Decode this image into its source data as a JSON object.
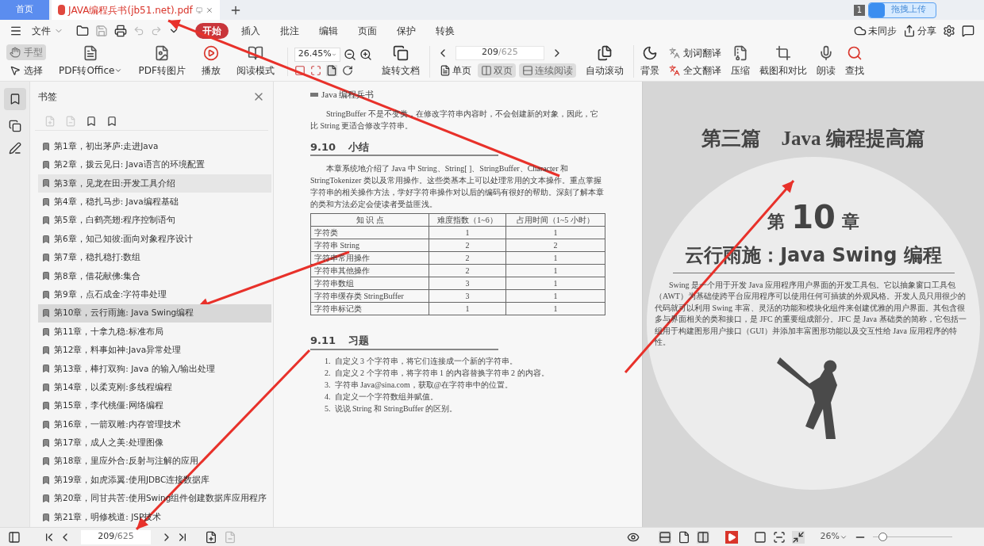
{
  "tabs": [
    {
      "label": "首页",
      "selected": false,
      "kind": "home"
    },
    {
      "label": "JAVA编程兵书(jb51.net).pdf",
      "selected": true,
      "kind": "document"
    }
  ],
  "window_badge": "1",
  "upload_button": "拖拽上传",
  "menu": {
    "file": "文件",
    "tabs": [
      {
        "label": "开始",
        "selected": true
      },
      {
        "label": "插入",
        "selected": false
      },
      {
        "label": "批注",
        "selected": false
      },
      {
        "label": "编辑",
        "selected": false
      },
      {
        "label": "页面",
        "selected": false
      },
      {
        "label": "保护",
        "selected": false
      },
      {
        "label": "转换",
        "selected": false
      }
    ],
    "sync": "未同步",
    "share": "分享"
  },
  "toolbar": {
    "modes": [
      {
        "label": "手型",
        "selected": true,
        "kind": "hand"
      },
      {
        "label": "选择",
        "selected": false,
        "kind": "select"
      }
    ],
    "tools": [
      {
        "label": "PDF转Office",
        "kind": "office",
        "dropdown": true
      },
      {
        "label": "PDF转图片",
        "kind": "image",
        "dropdown": false
      },
      {
        "label": "播放",
        "kind": "play",
        "dropdown": false
      },
      {
        "label": "阅读模式",
        "kind": "read",
        "dropdown": false
      }
    ],
    "zoom": "26.45%",
    "rotate": "旋转文档",
    "page": "209",
    "page_total": "/625",
    "views": [
      {
        "label": "单页",
        "selected": false,
        "kind": "single"
      },
      {
        "label": "双页",
        "selected": true,
        "kind": "double"
      },
      {
        "label": "连续阅读",
        "selected": true,
        "kind": "continuous"
      }
    ],
    "auto_scroll": "自动滚动",
    "background": "背景",
    "translate": [
      {
        "label": "划词翻译",
        "kind": "word"
      },
      {
        "label": "全文翻译",
        "kind": "full"
      }
    ],
    "tools2": [
      {
        "label": "压缩",
        "kind": "compress"
      },
      {
        "label": "截图和对比",
        "kind": "screenshot"
      },
      {
        "label": "朗读",
        "kind": "read-aloud"
      },
      {
        "label": "查找",
        "kind": "find"
      }
    ]
  },
  "sidebar": {
    "title": "书签",
    "items": [
      {
        "label": "第1章，初出茅庐:走进Java",
        "selected": false,
        "hovered": false
      },
      {
        "label": "第2章，拨云见日: Java语言的环境配置",
        "selected": false,
        "hovered": false
      },
      {
        "label": "第3章，见龙在田:开发工具介绍",
        "selected": false,
        "hovered": true
      },
      {
        "label": "第4章，稳扎马步: Java编程基础",
        "selected": false,
        "hovered": false
      },
      {
        "label": "第5章，白鹤亮翅:程序控制语句",
        "selected": false,
        "hovered": false
      },
      {
        "label": "第6章，知己知彼:面向对象程序设计",
        "selected": false,
        "hovered": false
      },
      {
        "label": "第7章，稳扎稳打:数组",
        "selected": false,
        "hovered": false
      },
      {
        "label": "第8章，借花献佛:集合",
        "selected": false,
        "hovered": false
      },
      {
        "label": "第9章，点石成金:字符串处理",
        "selected": false,
        "hovered": false
      },
      {
        "label": "第10章，云行雨施: Java Swing编程",
        "selected": true,
        "hovered": false
      },
      {
        "label": "第11章，十拿九稳:标准布局",
        "selected": false,
        "hovered": false
      },
      {
        "label": "第12章，料事如神:Java异常处理",
        "selected": false,
        "hovered": false
      },
      {
        "label": "第13章，棒打双狗: Java 的输入/输出处理",
        "selected": false,
        "hovered": false
      },
      {
        "label": "第14章，以柔克刚:多线程编程",
        "selected": false,
        "hovered": false
      },
      {
        "label": "第15章，李代桃僵:网络编程",
        "selected": false,
        "hovered": false
      },
      {
        "label": "第16章，一箭双雕:内存管理技术",
        "selected": false,
        "hovered": false
      },
      {
        "label": "第17章，成人之美:处理图像",
        "selected": false,
        "hovered": false
      },
      {
        "label": "第18章，里应外合:反射与注解的应用",
        "selected": false,
        "hovered": false
      },
      {
        "label": "第19章，如虎添翼:使用JDBC连接数据库",
        "selected": false,
        "hovered": false
      },
      {
        "label": "第20章，同甘共苦:使用Swing组件创建数据库应用程序",
        "selected": false,
        "hovered": false
      },
      {
        "label": "第21章，明修栈道: JSP技术",
        "selected": false,
        "hovered": false
      }
    ]
  },
  "left_page": {
    "header": "Java 编程兵书",
    "intro": "StringBuffer 不是不变类，在修改字符串内容时，不会创建新的对象，因此，它比 String 更适合修改字符串。",
    "section1": {
      "number": "9.10",
      "title": "小结"
    },
    "summary": "本章系统地介绍了 Java 中 String、String[ ]、StringBuffer、Character 和 StringTokenizer 类以及常用操作。这些类基本上可以处理常用的文本操作。重点掌握字符串的相关操作方法，学好字符串操作对以后的编码有很好的帮助。深刻了解本章的类和方法必定会使读者受益匪浅。",
    "table": {
      "columns": [
        "知  识  点",
        "难度指数（1~6）",
        "占用时间（1~5 小时）"
      ],
      "rows": [
        [
          "字符类",
          "1",
          "1"
        ],
        [
          "字符串 String",
          "2",
          "2"
        ],
        [
          "字符串常用操作",
          "2",
          "1"
        ],
        [
          "字符串其他操作",
          "2",
          "1"
        ],
        [
          "字符串数组",
          "3",
          "1"
        ],
        [
          "字符串缓存类 StringBuffer",
          "3",
          "1"
        ],
        [
          "字符串标记类",
          "1",
          "1"
        ]
      ]
    },
    "section2": {
      "number": "9.11",
      "title": "习题"
    },
    "exercises": [
      "1.  自定义 3 个字符串，将它们连接成一个新的字符串。",
      "2.  自定义 2 个字符串，将字符串 1 的内容替换字符串 2 的内容。",
      "3.  字符串 Java@sina.com，获取@在字符串中的位置。",
      "4.  自定义一个字符数组并赋值。",
      "5.  说说 String 和 StringBuffer 的区别。"
    ]
  },
  "right_page": {
    "part_title": "第三篇　Java 编程提高篇",
    "chapter_prefix": "第",
    "chapter_number": "10",
    "chapter_suffix": "章",
    "chapter_title": "云行雨施：Java Swing 编程",
    "body": "Swing 是一个用于开发 Java 应用程序用户界面的开发工具包。它以抽象窗口工具包（AWT）为基础使跨平台应用程序可以使用任何可插拔的外观风格。开发人员只用很少的代码就可以利用 Swing 丰富、灵活的功能和模块化组件来创建优雅的用户界面。其包含很多与界面相关的类和接口，是 JFC 的重要组成部分。JFC 是 Java 基础类的简称，它包括一组用于构建图形用户接口（GUI）并添加丰富图形功能以及交互性给 Java 应用程序的特性。"
  },
  "status_bar": {
    "page": "209",
    "page_total": "/625",
    "zoom": "26%",
    "zoom_level": {
      "level": 0.12
    }
  }
}
